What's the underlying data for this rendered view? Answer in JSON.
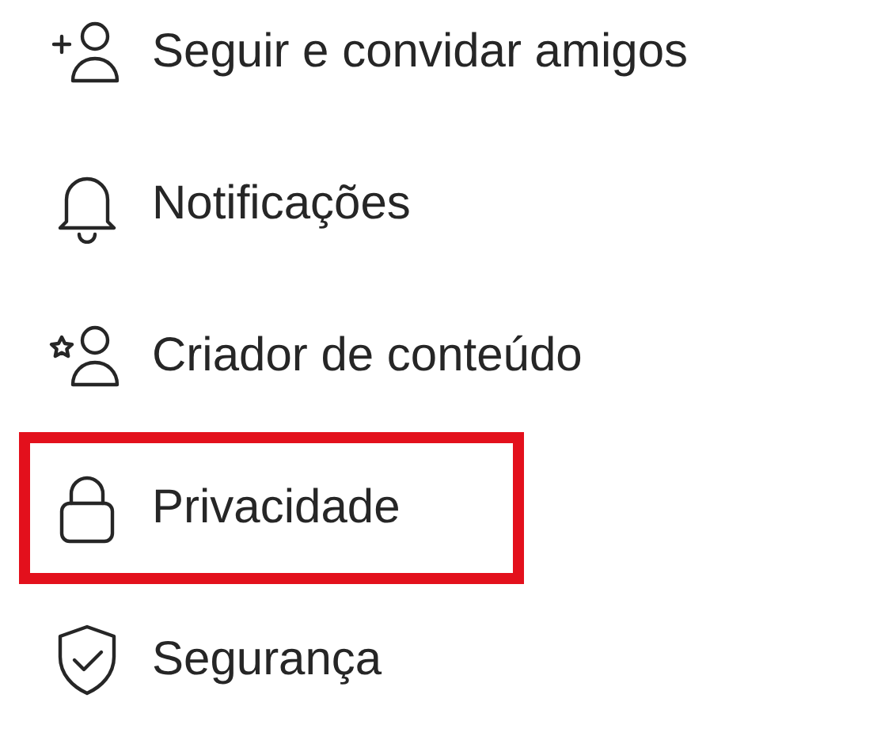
{
  "menu": {
    "items": [
      {
        "label": "Seguir e convidar amigos",
        "kind": "add-person",
        "highlighted": false
      },
      {
        "label": "Notificações",
        "kind": "bell",
        "highlighted": false
      },
      {
        "label": "Criador de conteúdo",
        "kind": "star-person",
        "highlighted": false
      },
      {
        "label": "Privacidade",
        "kind": "lock",
        "highlighted": true
      },
      {
        "label": "Segurança",
        "kind": "shield",
        "highlighted": false
      }
    ]
  }
}
